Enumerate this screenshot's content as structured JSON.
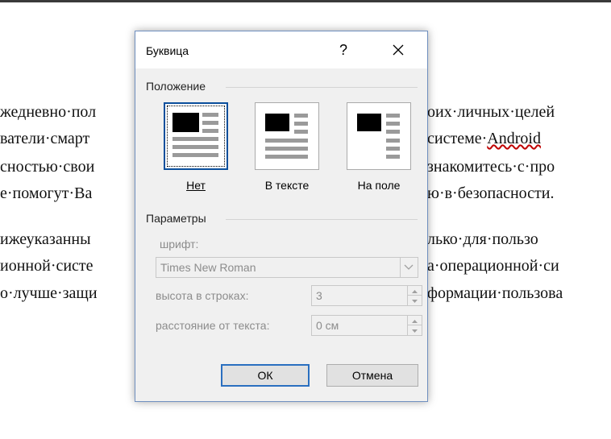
{
  "document": {
    "lines": [
      "жедневно·пол",
      "oих·личных·целей",
      "ватели·смарт",
      "системе·",
      "Android",
      "сностью·свои",
      "знакомитесь·с·про",
      "е·помогут·Ва",
      "ю·в·безопасности.",
      "ижеуказанны",
      "лько·для·пользо",
      "ионной·систе",
      "а·операционной·си",
      "о·лучше·защи",
      "формации·пользова"
    ]
  },
  "dialog": {
    "title": "Буквица",
    "help": "?",
    "position_section": "Положение",
    "options": [
      {
        "label": "Нет",
        "selected": true
      },
      {
        "label": "В тексте",
        "selected": false
      },
      {
        "label": "На поле",
        "selected": false
      }
    ],
    "params_section": "Параметры",
    "font_label": "шрифт:",
    "font_value": "Times New Roman",
    "lines_label": "высота в строках:",
    "lines_value": "3",
    "distance_label": "расстояние от текста:",
    "distance_value": "0 см",
    "ok_label": "ОК",
    "cancel_label": "Отмена"
  },
  "colors": {
    "accent": "#2a6fc0",
    "underline_wavy": "#c00000"
  }
}
